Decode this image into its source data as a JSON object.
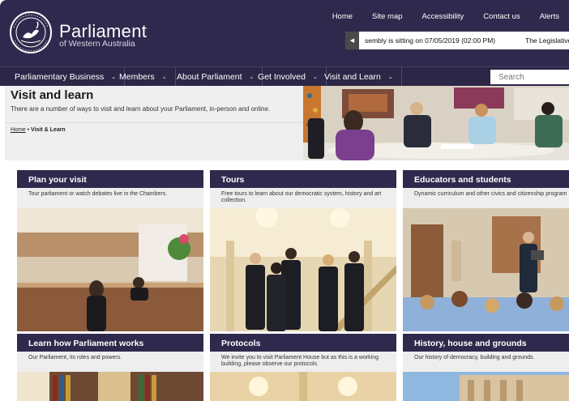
{
  "header": {
    "brand_title": "Parliament",
    "brand_subtitle": "of Western Australia",
    "crest_text": "PARLIAMENT · WESTERN AUSTRALIA",
    "top_links": [
      "Home",
      "Site map",
      "Accessibility",
      "Contact us",
      "Alerts"
    ],
    "ticker_text": "sembly is sitting on 07/05/2019 (02:00 PM)",
    "ticker_text_2": "The Legislative"
  },
  "nav": {
    "items": [
      "Parliamentary Business",
      "Members",
      "About Parliament",
      "Get Involved",
      "Visit and Learn"
    ],
    "search_placeholder": "Search"
  },
  "intro": {
    "title": "Visit and learn",
    "text": "There are a number of ways to visit and learn about your Parliament, in-person and online.",
    "breadcrumb": {
      "home": "Home",
      "separator": "•",
      "current": "Visit & Learn"
    }
  },
  "cards": [
    {
      "title": "Plan your visit",
      "description": "Tour parliament or watch debates live in the Chambers."
    },
    {
      "title": "Tours",
      "description": "Free tours to learn about our democratic system, history and art collection."
    },
    {
      "title": "Educators and students",
      "description": "Dynamic curriculum and other civics and citizenship program"
    },
    {
      "title": "Learn how Parliament works",
      "description": "Our Parliament, its roles and powers."
    },
    {
      "title": "Protocols",
      "description": "We invite you to visit Parliament House but as this is a working building, please observe our protocols."
    },
    {
      "title": "History, house and grounds",
      "description": "Our history of democracy, building and grounds."
    }
  ],
  "colors": {
    "header_bg": "#2f2a4d",
    "card_head_bg": "#2f2a4d",
    "desc_bg": "#eeeeee"
  }
}
